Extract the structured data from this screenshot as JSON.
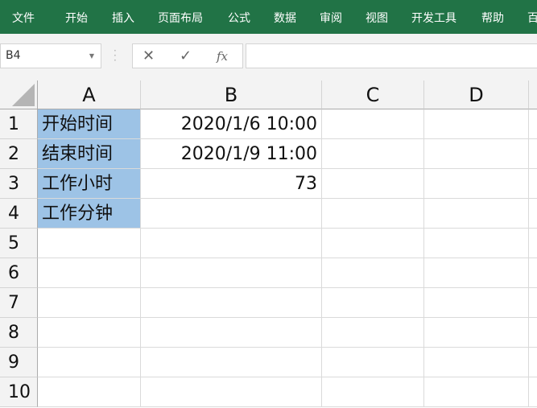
{
  "ribbon": {
    "tabs": [
      "文件",
      "开始",
      "插入",
      "页面布局",
      "公式",
      "数据",
      "审阅",
      "视图",
      "开发工具",
      "帮助",
      "百"
    ]
  },
  "formula_bar": {
    "name_box": "B4",
    "cancel_icon": "✕",
    "enter_icon": "✓",
    "fx_label": "fx",
    "formula": ""
  },
  "columns": [
    "A",
    "B",
    "C",
    "D"
  ],
  "rows": [
    "1",
    "2",
    "3",
    "4",
    "5",
    "6",
    "7",
    "8",
    "9",
    "10"
  ],
  "cells": [
    [
      "开始时间",
      "2020/1/6 10:00"
    ],
    [
      "结束时间",
      "2020/1/9 11:00"
    ],
    [
      "工作小时",
      "73"
    ],
    [
      "工作分钟",
      ""
    ]
  ],
  "colors": {
    "ribbon": "#217346",
    "selection": "#9dc3e6"
  }
}
